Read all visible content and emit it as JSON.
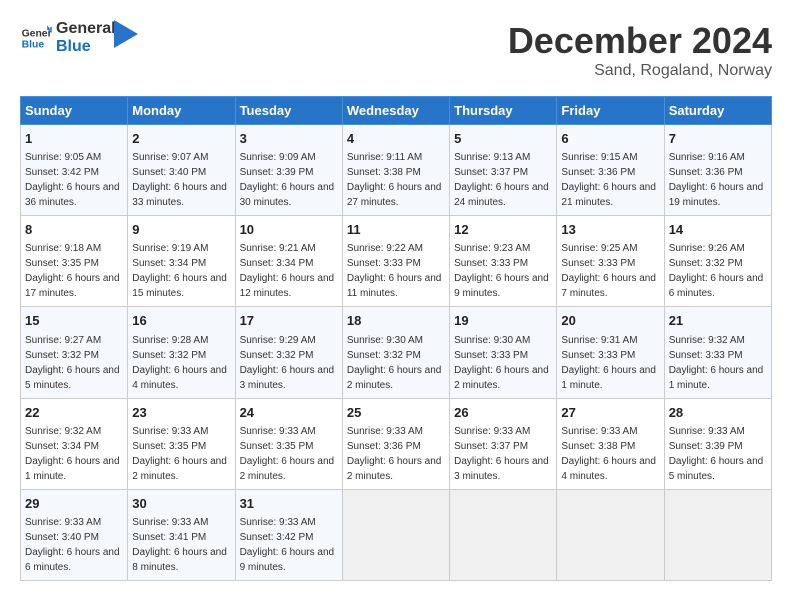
{
  "header": {
    "logo_general": "General",
    "logo_blue": "Blue",
    "month_title": "December 2024",
    "location": "Sand, Rogaland, Norway"
  },
  "columns": [
    "Sunday",
    "Monday",
    "Tuesday",
    "Wednesday",
    "Thursday",
    "Friday",
    "Saturday"
  ],
  "weeks": [
    [
      {
        "day": "1",
        "sunrise": "9:05 AM",
        "sunset": "3:42 PM",
        "daylight": "6 hours and 36 minutes."
      },
      {
        "day": "2",
        "sunrise": "9:07 AM",
        "sunset": "3:40 PM",
        "daylight": "6 hours and 33 minutes."
      },
      {
        "day": "3",
        "sunrise": "9:09 AM",
        "sunset": "3:39 PM",
        "daylight": "6 hours and 30 minutes."
      },
      {
        "day": "4",
        "sunrise": "9:11 AM",
        "sunset": "3:38 PM",
        "daylight": "6 hours and 27 minutes."
      },
      {
        "day": "5",
        "sunrise": "9:13 AM",
        "sunset": "3:37 PM",
        "daylight": "6 hours and 24 minutes."
      },
      {
        "day": "6",
        "sunrise": "9:15 AM",
        "sunset": "3:36 PM",
        "daylight": "6 hours and 21 minutes."
      },
      {
        "day": "7",
        "sunrise": "9:16 AM",
        "sunset": "3:36 PM",
        "daylight": "6 hours and 19 minutes."
      }
    ],
    [
      {
        "day": "8",
        "sunrise": "9:18 AM",
        "sunset": "3:35 PM",
        "daylight": "6 hours and 17 minutes."
      },
      {
        "day": "9",
        "sunrise": "9:19 AM",
        "sunset": "3:34 PM",
        "daylight": "6 hours and 15 minutes."
      },
      {
        "day": "10",
        "sunrise": "9:21 AM",
        "sunset": "3:34 PM",
        "daylight": "6 hours and 12 minutes."
      },
      {
        "day": "11",
        "sunrise": "9:22 AM",
        "sunset": "3:33 PM",
        "daylight": "6 hours and 11 minutes."
      },
      {
        "day": "12",
        "sunrise": "9:23 AM",
        "sunset": "3:33 PM",
        "daylight": "6 hours and 9 minutes."
      },
      {
        "day": "13",
        "sunrise": "9:25 AM",
        "sunset": "3:33 PM",
        "daylight": "6 hours and 7 minutes."
      },
      {
        "day": "14",
        "sunrise": "9:26 AM",
        "sunset": "3:32 PM",
        "daylight": "6 hours and 6 minutes."
      }
    ],
    [
      {
        "day": "15",
        "sunrise": "9:27 AM",
        "sunset": "3:32 PM",
        "daylight": "6 hours and 5 minutes."
      },
      {
        "day": "16",
        "sunrise": "9:28 AM",
        "sunset": "3:32 PM",
        "daylight": "6 hours and 4 minutes."
      },
      {
        "day": "17",
        "sunrise": "9:29 AM",
        "sunset": "3:32 PM",
        "daylight": "6 hours and 3 minutes."
      },
      {
        "day": "18",
        "sunrise": "9:30 AM",
        "sunset": "3:32 PM",
        "daylight": "6 hours and 2 minutes."
      },
      {
        "day": "19",
        "sunrise": "9:30 AM",
        "sunset": "3:33 PM",
        "daylight": "6 hours and 2 minutes."
      },
      {
        "day": "20",
        "sunrise": "9:31 AM",
        "sunset": "3:33 PM",
        "daylight": "6 hours and 1 minute."
      },
      {
        "day": "21",
        "sunrise": "9:32 AM",
        "sunset": "3:33 PM",
        "daylight": "6 hours and 1 minute."
      }
    ],
    [
      {
        "day": "22",
        "sunrise": "9:32 AM",
        "sunset": "3:34 PM",
        "daylight": "6 hours and 1 minute."
      },
      {
        "day": "23",
        "sunrise": "9:33 AM",
        "sunset": "3:35 PM",
        "daylight": "6 hours and 2 minutes."
      },
      {
        "day": "24",
        "sunrise": "9:33 AM",
        "sunset": "3:35 PM",
        "daylight": "6 hours and 2 minutes."
      },
      {
        "day": "25",
        "sunrise": "9:33 AM",
        "sunset": "3:36 PM",
        "daylight": "6 hours and 2 minutes."
      },
      {
        "day": "26",
        "sunrise": "9:33 AM",
        "sunset": "3:37 PM",
        "daylight": "6 hours and 3 minutes."
      },
      {
        "day": "27",
        "sunrise": "9:33 AM",
        "sunset": "3:38 PM",
        "daylight": "6 hours and 4 minutes."
      },
      {
        "day": "28",
        "sunrise": "9:33 AM",
        "sunset": "3:39 PM",
        "daylight": "6 hours and 5 minutes."
      }
    ],
    [
      {
        "day": "29",
        "sunrise": "9:33 AM",
        "sunset": "3:40 PM",
        "daylight": "6 hours and 6 minutes."
      },
      {
        "day": "30",
        "sunrise": "9:33 AM",
        "sunset": "3:41 PM",
        "daylight": "6 hours and 8 minutes."
      },
      {
        "day": "31",
        "sunrise": "9:33 AM",
        "sunset": "3:42 PM",
        "daylight": "6 hours and 9 minutes."
      },
      null,
      null,
      null,
      null
    ]
  ],
  "labels": {
    "sunrise": "Sunrise:",
    "sunset": "Sunset:",
    "daylight": "Daylight:"
  }
}
